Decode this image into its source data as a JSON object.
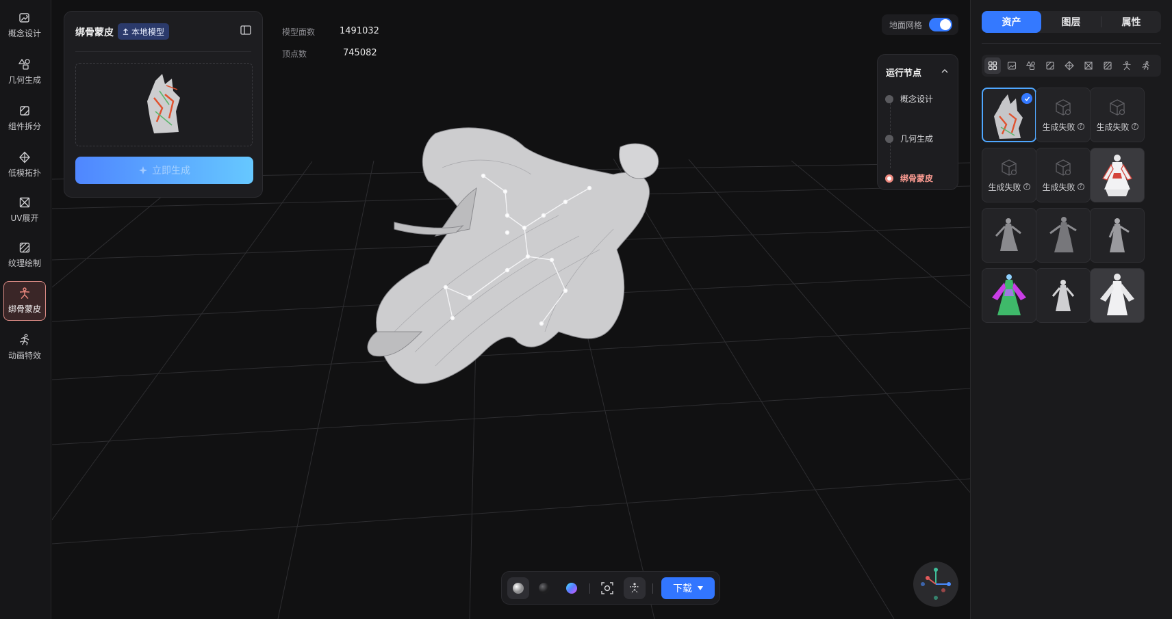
{
  "nav": {
    "items": [
      {
        "label": "概念设计",
        "icon": "concept-design-icon"
      },
      {
        "label": "几何生成",
        "icon": "geometry-shapes-icon"
      },
      {
        "label": "组件拆分",
        "icon": "component-split-icon"
      },
      {
        "label": "低模拓扑",
        "icon": "low-poly-topology-icon"
      },
      {
        "label": "UV展开",
        "icon": "uv-unwrap-icon"
      },
      {
        "label": "纹理绘制",
        "icon": "texture-paint-icon"
      },
      {
        "label": "绑骨蒙皮",
        "icon": "rigging-figure-icon",
        "active": true
      },
      {
        "label": "动画特效",
        "icon": "animation-running-icon"
      }
    ],
    "active_color": "#d98a84"
  },
  "gen_panel": {
    "title": "绑骨蒙皮",
    "badge": "本地模型",
    "generate_label": "立即生成"
  },
  "stats": {
    "faces_label": "模型面数",
    "faces_value": "1491032",
    "vertices_label": "顶点数",
    "vertices_value": "745082"
  },
  "ground_grid": {
    "label": "地面网格",
    "enabled": true
  },
  "run_nodes": {
    "title": "运行节点",
    "nodes": [
      {
        "label": "概念设计",
        "state": "done"
      },
      {
        "label": "几何生成",
        "state": "done"
      },
      {
        "label": "绑骨蒙皮",
        "state": "active"
      }
    ]
  },
  "toolbar": {
    "buttons": [
      "white-material-sphere-icon",
      "dark-material-sphere-icon",
      "color-material-sphere-icon",
      "focus-frame-icon",
      "skeleton-toggle-icon"
    ],
    "download_label": "下载"
  },
  "right_panel": {
    "tabs": [
      {
        "label": "资产",
        "active": true
      },
      {
        "label": "图层",
        "active": false
      },
      {
        "label": "属性",
        "active": false
      }
    ],
    "filters": [
      "all-grid-icon",
      "concept-design-icon",
      "geometry-shapes-icon",
      "component-split-icon",
      "low-poly-topology-icon",
      "uv-unwrap-icon",
      "texture-paint-icon",
      "rigging-figure-icon",
      "animation-running-icon"
    ],
    "assets": [
      {
        "type": "thumb",
        "style": "rigged-colored",
        "selected": true
      },
      {
        "type": "failed",
        "label": "生成失败"
      },
      {
        "type": "failed",
        "label": "生成失败"
      },
      {
        "type": "failed",
        "label": "生成失败"
      },
      {
        "type": "failed",
        "label": "生成失败"
      },
      {
        "type": "thumb",
        "style": "red-white-robe"
      },
      {
        "type": "thumb",
        "style": "grey-figure"
      },
      {
        "type": "thumb",
        "style": "grey-figure-dark"
      },
      {
        "type": "thumb",
        "style": "grey-figure"
      },
      {
        "type": "thumb",
        "style": "green-purple-robe"
      },
      {
        "type": "thumb",
        "style": "white-figure"
      },
      {
        "type": "thumb",
        "style": "white-robe-wide"
      }
    ]
  },
  "colors": {
    "accent": "#3479ff",
    "generate_gradient_start": "#4f86ff",
    "generate_gradient_end": "#66c8ff",
    "active_node": "#ef8a80"
  }
}
